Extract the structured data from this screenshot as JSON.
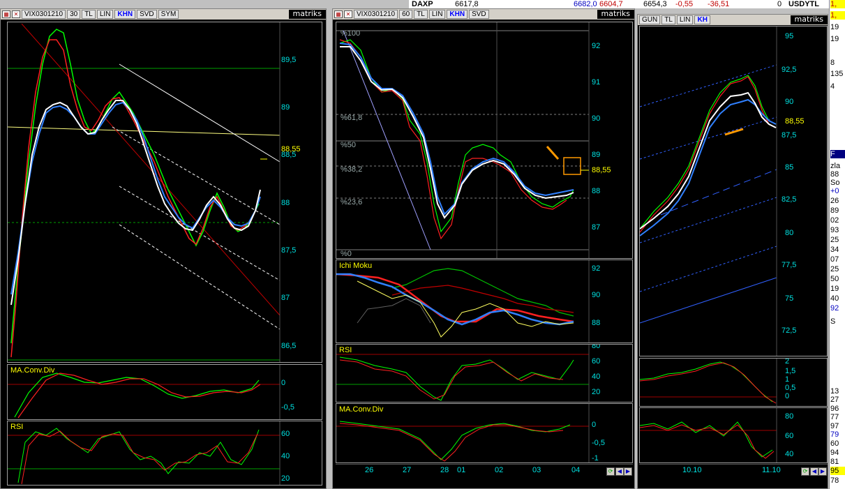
{
  "top_strip": {
    "symbol": "DAXP",
    "value1": "6617,8",
    "value2": "6682,0",
    "value3": "6604,7",
    "value4": "6654,3",
    "change": "-0,55",
    "change_abs": "-36,51",
    "zero": "0",
    "pair": "USDYTL"
  },
  "window1": {
    "symbol": "VIX0301210",
    "interval": "30",
    "buttons": [
      "TL",
      "LIN",
      "KHN",
      "SVD",
      "SYM"
    ],
    "logo": "matriks",
    "price_ticks": [
      "89,5",
      "89",
      "88,5",
      "88",
      "87,5",
      "87",
      "86,5"
    ],
    "last_price": "88,55",
    "indicator1": {
      "title": "MA.Conv.Div",
      "ticks": [
        "0",
        "-0,5"
      ]
    },
    "indicator2": {
      "title": "RSI",
      "ticks": [
        "60",
        "40",
        "20"
      ]
    }
  },
  "window2": {
    "symbol": "VIX0301210",
    "interval": "60",
    "buttons": [
      "TL",
      "LIN",
      "KHN",
      "SVD"
    ],
    "logo": "matriks",
    "price_ticks": [
      "92",
      "91",
      "90",
      "89",
      "88",
      "87"
    ],
    "last_price": "88,55",
    "fib_levels": [
      "%100",
      "%61,8",
      "%50",
      "%38,2",
      "%23,6",
      "%0"
    ],
    "ichimoku": {
      "title": "Ichi Moku",
      "ticks": [
        "92",
        "90",
        "88"
      ]
    },
    "rsi": {
      "title": "RSI",
      "ticks": [
        "80",
        "60",
        "40",
        "20"
      ]
    },
    "macd": {
      "title": "MA.Conv.Div",
      "ticks": [
        "0",
        "-0,5",
        "-1"
      ]
    },
    "dates": [
      "26",
      "27",
      "28",
      "01",
      "02",
      "03",
      "04"
    ]
  },
  "window3": {
    "buttons": [
      "GUN",
      "TL",
      "LIN",
      "KH"
    ],
    "logo": "matriks",
    "price_ticks": [
      "95",
      "92,5",
      "90",
      "87,5",
      "85",
      "82,5",
      "80",
      "77,5",
      "75",
      "72,5"
    ],
    "last_price": "88,55",
    "ind1_ticks": [
      "2",
      "1,5",
      "1",
      "0,5",
      "0"
    ],
    "ind2_ticks": [
      "80",
      "60",
      "40"
    ],
    "dates": [
      "10.10",
      "11.10"
    ]
  },
  "right_column": [
    "1,",
    "1,",
    "19",
    "19",
    "8",
    "135",
    "4",
    "F",
    "zla",
    "88",
    "So",
    "+0",
    "26",
    "89",
    "02",
    "93",
    "25",
    "34",
    "07",
    "25",
    "50",
    "19",
    "40",
    "92",
    "S",
    "13",
    "27",
    "96",
    "77",
    "97",
    "79",
    "60",
    "94",
    "81",
    "95",
    "78"
  ]
}
